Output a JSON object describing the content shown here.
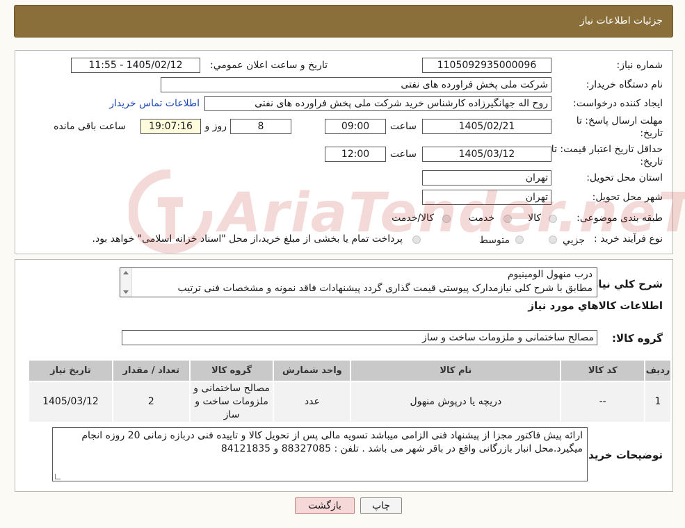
{
  "header": {
    "title": "جزئیات اطلاعات نیاز"
  },
  "need": {
    "number_label": "شماره نیاز:",
    "number_value": "1105092935000096",
    "announce_label": "تاریخ و ساعت اعلان عمومي:",
    "announce_value": "1405/02/12 - 11:55",
    "buyer_label": "نام دستگاه خریدار:",
    "buyer_value": "شرکت ملی پخش فراورده های نفتی",
    "creator_label": "ایجاد کننده درخواست:",
    "creator_value": "روح اله جهانگیرزاده کارشناس خرید شرکت ملی پخش فراورده های نفتی",
    "contact_link": "اطلاعات تماس خریدار",
    "deadline_label_1": "مهلت ارسال پاسخ: تا",
    "deadline_label_2": "تاریخ:",
    "deadline_date": "1405/02/21",
    "time_label": "ساعت",
    "deadline_time": "09:00",
    "days_value": "8",
    "days_label": "روز و",
    "remaining_value": "19:07:16",
    "remaining_label": "ساعت باقی مانده",
    "validity_label_1": "حداقل تاریخ اعتبار قیمت: تا",
    "validity_label_2": "تاریخ:",
    "validity_date": "1405/03/12",
    "validity_time_label": "ساعت",
    "validity_time": "12:00",
    "province_label": "استان محل تحویل:",
    "province_value": "تهران",
    "city_label": "شهر محل تحویل:",
    "city_value": "تهران",
    "category_label": "طبقه بندی موضوعی:",
    "category_options": [
      "کالا",
      "خدمت",
      "کالا/خدمت"
    ],
    "process_label": "نوع فرآیند خرید :",
    "process_options": [
      "جزیي",
      "متوسط"
    ],
    "process_note": "پرداخت تمام یا بخشی از مبلغ خرید،از محل \"اسناد خزانه اسلامی\" خواهد بود."
  },
  "description": {
    "label": "شرح کلي نیاز:",
    "line1": "درب منهول الومینیوم",
    "line2": "مطابق با شرح کلی نیازمدارک پیوستی قیمت گذاری گردد پیشنهادات فاقد نمونه و مشخصات فنی ترتیب"
  },
  "goods": {
    "section_title": "اطلاعات کالاهاي مورد نیاز",
    "group_label": "گروه کالا:",
    "group_value": "مصالح ساختمانی و ملزومات ساخت و ساز",
    "columns": [
      "ردیف",
      "کد کالا",
      "نام کالا",
      "واحد شمارش",
      "گروه کالا",
      "تعداد / مقدار",
      "تاریخ نیاز"
    ],
    "rows": [
      {
        "index": "1",
        "code": "--",
        "name": "دریچه یا درپوش منهول",
        "unit": "عدد",
        "group": "مصالح ساختمانی و ملزومات ساخت و ساز",
        "qty": "2",
        "date": "1405/03/12"
      }
    ]
  },
  "buyer_notes": {
    "label": "توضیحات خریدار:",
    "line1": "ارائه پیش فاکتور مجزا از پیشنهاد فنی الزامی میباشد تسویه مالی پس از تحویل کالا و تاییده فنی دربازه زمانی 20 روزه انجام",
    "line2": "میگیرد.محل انبار بازرگانی واقع در باقر شهر می باشد . تلفن : 88327085 و 84121835"
  },
  "buttons": {
    "print": "چاپ",
    "back": "بازگشت"
  },
  "watermark": {
    "text": "AriaTender.neT"
  },
  "colors": {
    "header_bg": "#8a6f3a",
    "link": "#1b46b8",
    "back_btn": "#f7d8d8",
    "remaining_bg": "#fefcdc"
  }
}
